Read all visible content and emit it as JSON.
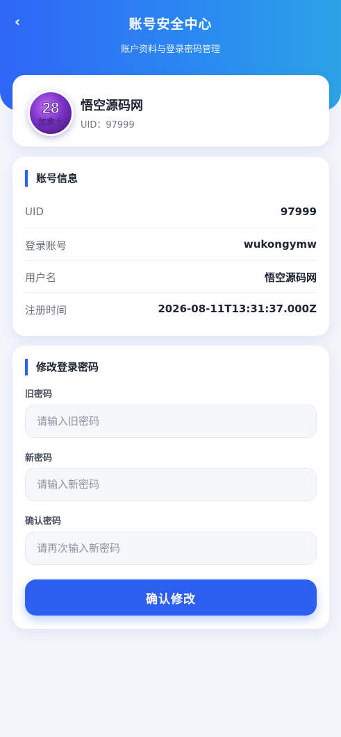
{
  "header": {
    "back_icon": "chevron-left-icon",
    "back_glyph": "‹",
    "title": "账号安全中心",
    "subtitle": "账户资料与登录密码管理",
    "gradient": [
      "#2f66f6",
      "#2ca3e6"
    ]
  },
  "profile": {
    "avatar_text": "28",
    "avatar_subtext": "加拿大",
    "name": "悟空源码网",
    "uid_label": "UID：97999"
  },
  "account_info": {
    "title": "账号信息",
    "rows": [
      {
        "label": "UID",
        "value": "97999"
      },
      {
        "label": "登录账号",
        "value": "wukongymw"
      },
      {
        "label": "用户名",
        "value": "悟空源码网"
      },
      {
        "label": "注册时间",
        "value": "2026-08-11T13:31:37.000Z"
      }
    ]
  },
  "change_password": {
    "title": "修改登录密码",
    "fields": [
      {
        "label": "旧密码",
        "placeholder": "请输入旧密码",
        "value": ""
      },
      {
        "label": "新密码",
        "placeholder": "请输入新密码",
        "value": ""
      },
      {
        "label": "确认密码",
        "placeholder": "请再次输入新密码",
        "value": ""
      }
    ],
    "submit_label": "确认修改"
  },
  "colors": {
    "accent": "#2b5ff0",
    "background": "#f3f5fb",
    "card": "#ffffff"
  }
}
